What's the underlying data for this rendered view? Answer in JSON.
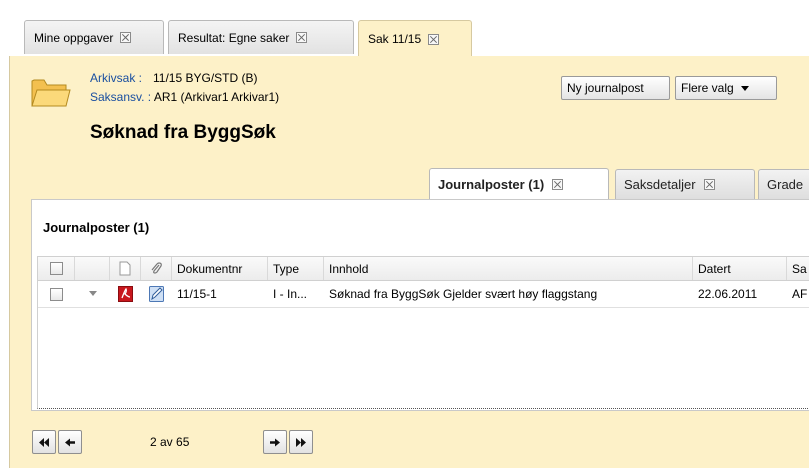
{
  "window_tabs": [
    {
      "label": "Mine oppgaver"
    },
    {
      "label": "Resultat: Egne saker"
    },
    {
      "label": "Sak 11/15"
    }
  ],
  "case": {
    "arkivsak_label": "Arkivsak :",
    "arkivsak_value": "11/15 BYG/STD (B)",
    "saksansv_label": "Saksansv. :",
    "saksansv_value": "AR1 (Arkivar1 Arkivar1)",
    "title": "Søknad fra ByggSøk"
  },
  "actions": {
    "new_journal": "Ny journalpost",
    "more": "Flere valg"
  },
  "sub_tabs": [
    {
      "label": "Journalposter (1)"
    },
    {
      "label": "Saksdetaljer"
    },
    {
      "label": "Grade"
    }
  ],
  "panel": {
    "title": "Journalposter (1)"
  },
  "grid": {
    "columns": [
      "Dokumentnr",
      "Type",
      "Innhold",
      "Datert",
      "Sa"
    ],
    "rows": [
      {
        "dokumentnr": "11/15-1",
        "type": "I - In...",
        "innhold": "Søknad fra ByggSøk Gjelder svært høy flaggstang",
        "datert": "22.06.2011",
        "sa": "AF"
      }
    ]
  },
  "pager": {
    "info": "2 av 65"
  },
  "colors": {
    "accent_bg": "#fdf1c8",
    "link": "#1a4fa0"
  }
}
